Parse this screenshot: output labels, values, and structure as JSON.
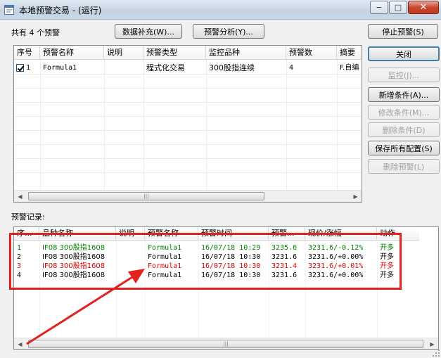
{
  "window": {
    "title": "本地预警交易 - (运行)",
    "btn_min": "−",
    "btn_max": "□",
    "btn_close": "✕"
  },
  "top_bar": {
    "count_label": "共有 4 个预警",
    "data_supplement": "数据补充(W)...",
    "warning_analysis": "预警分析(Y)...",
    "stop_warning": "停止预警(S)"
  },
  "side_buttons": {
    "close": "关闭",
    "monitor": "监控(J)...",
    "add_condition": "新增条件(A)...",
    "modify_condition": "修改条件(M)...",
    "delete_condition": "删除条件(D)",
    "save_all": "保存所有配置(S)",
    "delete_warning": "删除预警(L)"
  },
  "alerts_table": {
    "columns": [
      "序号",
      "预警名称",
      "说明",
      "预警类型",
      "监控品种",
      "预警数",
      "摘要"
    ],
    "rows": [
      {
        "index": "1",
        "name": "Formula1",
        "desc": "",
        "type": "程式化交易",
        "symbol": "300股指连续",
        "count": "4",
        "summary": "F.自编",
        "checked": true
      }
    ]
  },
  "records_label": "预警记录:",
  "records_table": {
    "columns": [
      "序...",
      "品种名称",
      "说明",
      "预警名称",
      "预警时间",
      "预警...",
      "现价/涨幅",
      "动作"
    ],
    "rows": [
      {
        "idx": "1",
        "symbol": "IF08 300股指1608",
        "desc": "",
        "name": "Formula1",
        "time": "16/07/18 10:29",
        "price": "3235.6",
        "change": "3231.6/-0.12%",
        "action": "开多",
        "color": "#008000"
      },
      {
        "idx": "2",
        "symbol": "IF08 300股指1608",
        "desc": "",
        "name": "Formula1",
        "time": "16/07/18 10:30",
        "price": "3231.6",
        "change": "3231.6/+0.00%",
        "action": "开多",
        "color": "#000000"
      },
      {
        "idx": "3",
        "symbol": "IF08 300股指1608",
        "desc": "",
        "name": "Formula1",
        "time": "16/07/18 10:30",
        "price": "3231.4",
        "change": "3231.6/+0.01%",
        "action": "开多",
        "color": "#e00000"
      },
      {
        "idx": "4",
        "symbol": "IF08 300股指1608",
        "desc": "",
        "name": "Formula1",
        "time": "16/07/18 10:30",
        "price": "3231.6",
        "change": "3231.6/+0.00%",
        "action": "开多",
        "color": "#000000"
      }
    ]
  },
  "scroll": {
    "left_arrow": "◀",
    "right_arrow": "▶",
    "grip": "|||"
  },
  "colors": {
    "highlight_box": "#e3221f",
    "arrow": "#e3221f"
  },
  "icons": {
    "app": "app-window-icon",
    "annotation": "red-arrow-annotation"
  }
}
